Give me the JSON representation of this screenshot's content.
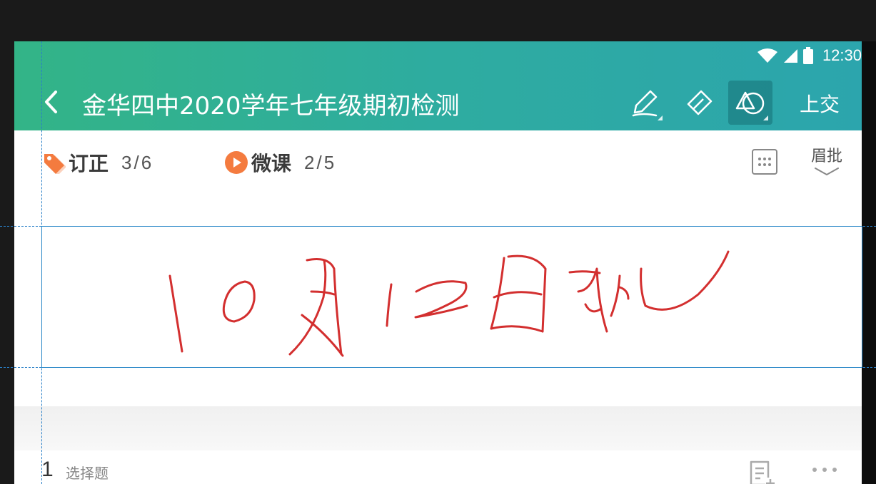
{
  "status_bar": {
    "time": "12:30"
  },
  "app_bar": {
    "title": "金华四中2020学年七年级期初检测",
    "submit_label": "上交",
    "colors": {
      "gradient_start": "#33b487",
      "gradient_end": "#2ca5ad"
    },
    "tools": [
      "pen-icon",
      "eraser-icon",
      "shape-icon"
    ]
  },
  "summary": {
    "correction": {
      "label": "订正",
      "count": "3/6",
      "icon": "tag-icon",
      "color": "#f47b3f"
    },
    "micro_lesson": {
      "label": "微课",
      "count": "2/5",
      "icon": "play-icon",
      "color": "#f47b3f"
    },
    "annotation_label": "眉批"
  },
  "handwritten_annotation": {
    "ink_color": "#d32f2f"
  },
  "question": {
    "number": "1",
    "type": "选择题"
  }
}
